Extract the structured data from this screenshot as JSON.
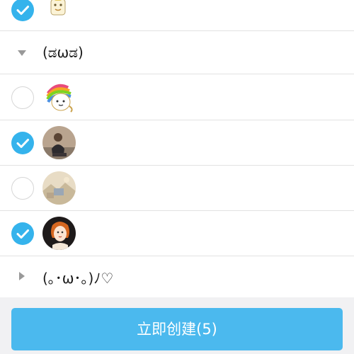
{
  "groups": [
    {
      "label": "(ಡωಡ)",
      "expanded": true
    },
    {
      "label": "(｡･ω･｡)ﾉ♡",
      "expanded": false
    }
  ],
  "contacts": [
    {
      "checked": true,
      "avatar": "cartoon-sticker"
    },
    {
      "checked": false,
      "avatar": "rainbow-cat-sticker"
    },
    {
      "checked": true,
      "avatar": "person-photo"
    },
    {
      "checked": false,
      "avatar": "landscape-photo"
    },
    {
      "checked": true,
      "avatar": "cartoon-girl"
    }
  ],
  "icons": {
    "check": "check-icon",
    "expanded": "triangle-down-icon",
    "collapsed": "triangle-right-icon"
  },
  "colors": {
    "accent": "#35b3ec",
    "button": "#4bb9ee",
    "divider": "#e2e2e2",
    "bottom_bar": "#f1f1f3"
  },
  "create_button": {
    "label": "立即创建(5)"
  }
}
